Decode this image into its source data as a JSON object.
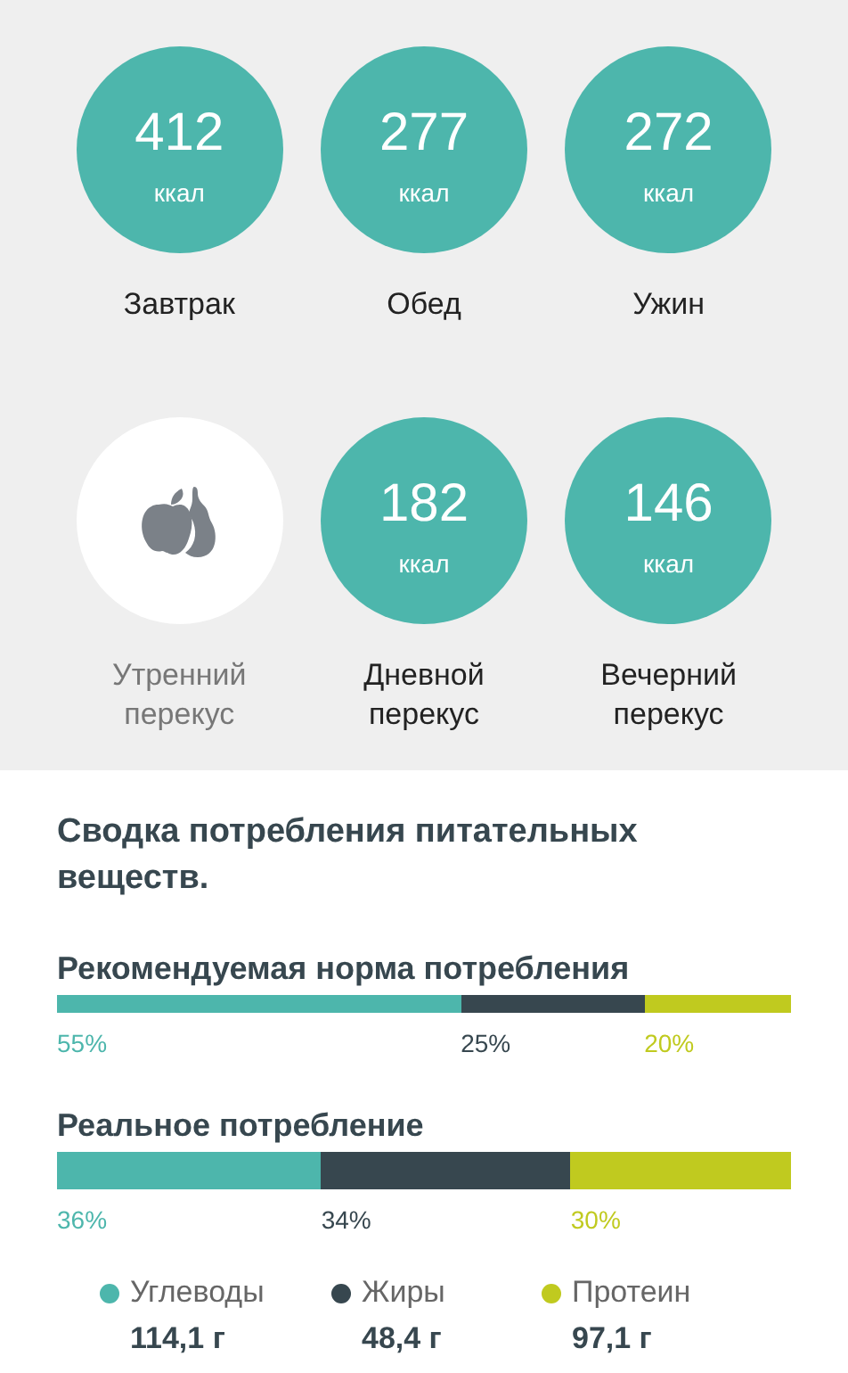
{
  "meals": [
    {
      "kind": "value",
      "value": "412",
      "unit": "ккал",
      "label": "Завтрак"
    },
    {
      "kind": "value",
      "value": "277",
      "unit": "ккал",
      "label": "Обед"
    },
    {
      "kind": "value",
      "value": "272",
      "unit": "ккал",
      "label": "Ужин"
    },
    {
      "kind": "empty",
      "label": "Утренний перекус"
    },
    {
      "kind": "value",
      "value": "182",
      "unit": "ккал",
      "label": "Дневной перекус"
    },
    {
      "kind": "value",
      "value": "146",
      "unit": "ккал",
      "label": "Вечерний перекус"
    }
  ],
  "summary": {
    "title": "Сводка потребления питательных веществ.",
    "bars": [
      {
        "title": "Рекомендуемая норма потребления",
        "kind": "thin",
        "segments": [
          {
            "color": "#4db6ac",
            "reading": "55%"
          },
          {
            "color": "#37474f",
            "reading": "25%"
          },
          {
            "color": "#c0ca1f",
            "reading": "20%"
          }
        ]
      },
      {
        "title": "Реальное потребление",
        "kind": "thick",
        "segments": [
          {
            "color": "#4db6ac",
            "reading": "36%"
          },
          {
            "color": "#37474f",
            "reading": "34%"
          },
          {
            "color": "#c0ca1f",
            "reading": "30%"
          }
        ]
      }
    ],
    "legend": [
      {
        "name": "Углеводы",
        "amount": "114,1 г",
        "color": "#4db6ac"
      },
      {
        "name": "Жиры",
        "amount": "48,4 г",
        "color": "#37474f"
      },
      {
        "name": "Протеин",
        "amount": "97,1 г",
        "color": "#c0ca1f"
      }
    ]
  }
}
